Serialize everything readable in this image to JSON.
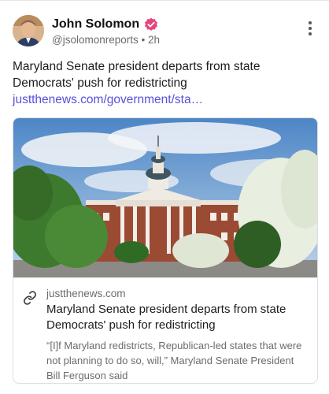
{
  "author": {
    "name": "John Solomon",
    "handle": "@jsolomonreports",
    "separator": "•",
    "time": "2h",
    "verified_color": "#e8457a"
  },
  "post": {
    "text": "Maryland Senate president departs from state Democrats' push for redistricting",
    "link_text": "justthenews.com/government/sta…"
  },
  "link_card": {
    "domain": "justthenews.com",
    "title": "Maryland Senate president departs from state Democrats' push for redistricting",
    "description": "“[I]f Maryland redistricts, Republican-led states that were not planning to do so, will,” Maryland Senate President Bill Ferguson said"
  },
  "colors": {
    "link": "#5b4fd8",
    "muted": "#6b6b70"
  }
}
